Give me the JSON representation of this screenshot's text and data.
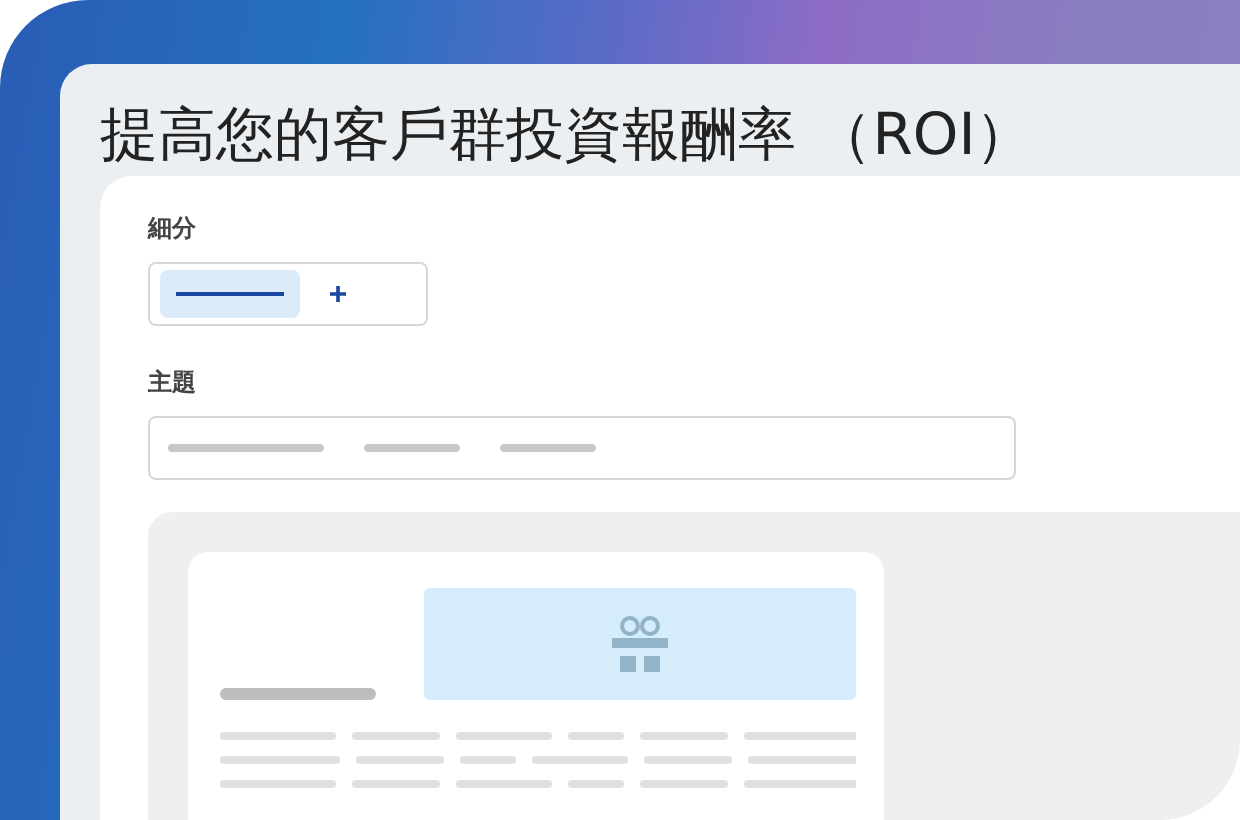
{
  "title": "提高您的客戶群投資報酬率 （ROI）",
  "fields": [
    {
      "label": "細分",
      "kind": "segments"
    },
    {
      "label": "主題",
      "kind": "subject"
    }
  ],
  "preview": {
    "kind": "email"
  }
}
